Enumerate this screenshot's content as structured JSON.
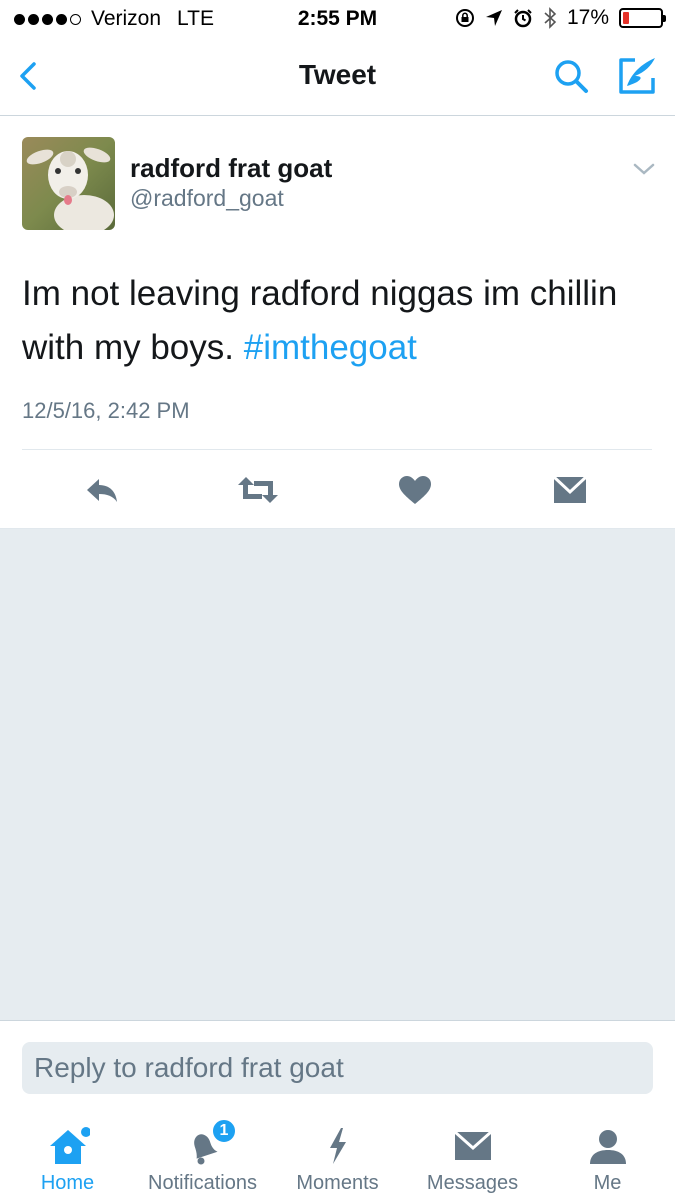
{
  "status_bar": {
    "signal_dots": 5,
    "signal_filled": 4,
    "carrier": "Verizon",
    "network": "LTE",
    "time": "2:55 PM",
    "battery_percent": "17%",
    "battery_level": 0.17,
    "battery_color": "#e5332a",
    "icons": [
      "orientation-lock-icon",
      "location-arrow-icon",
      "alarm-icon",
      "bluetooth-icon"
    ]
  },
  "nav": {
    "title": "Tweet",
    "back_icon": "chevron-left-icon",
    "search_icon": "search-icon",
    "compose_icon": "compose-tweet-icon",
    "accent": "#1da1f2"
  },
  "tweet": {
    "display_name": "radford frat goat",
    "handle": "@radford_goat",
    "text": "Im not leaving radford niggas im chillin with my boys. ",
    "hashtag": "#imthegoat",
    "timestamp": "12/5/16, 2:42 PM",
    "actions": [
      "reply-icon",
      "retweet-icon",
      "like-icon",
      "direct-message-icon"
    ]
  },
  "reply": {
    "placeholder": "Reply to radford frat goat"
  },
  "tabs": [
    {
      "label": "Home",
      "icon": "home-icon",
      "active": true
    },
    {
      "label": "Notifications",
      "icon": "bell-icon",
      "active": false,
      "badge": "1"
    },
    {
      "label": "Moments",
      "icon": "lightning-icon",
      "active": false
    },
    {
      "label": "Messages",
      "icon": "envelope-icon",
      "active": false
    },
    {
      "label": "Me",
      "icon": "person-icon",
      "active": false
    }
  ]
}
